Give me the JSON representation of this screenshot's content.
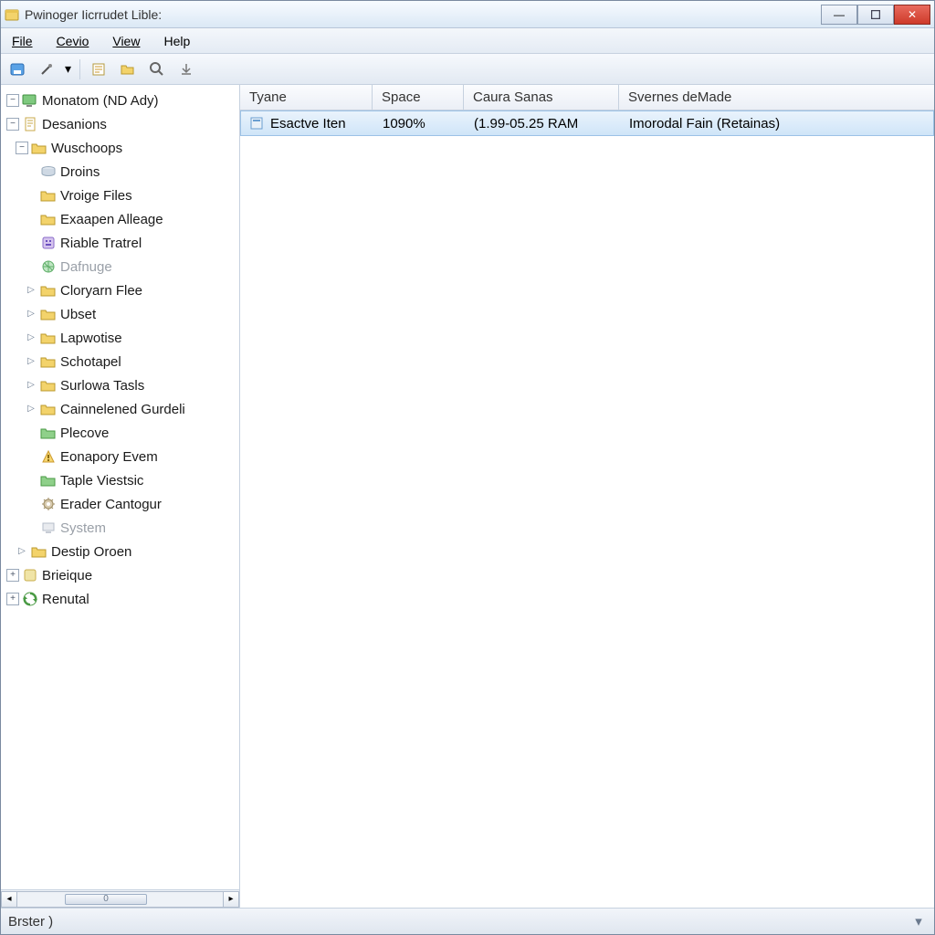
{
  "titlebar": {
    "title": "Pwinoger Iicrrudet Lible:"
  },
  "menu": {
    "file": "File",
    "cevio": "Cevio",
    "view": "View",
    "help": "Help"
  },
  "tree": {
    "root0": "Monatom (ND Ady)",
    "root1": "Desanions",
    "wuschoops": "Wuschoops",
    "droins": "Droins",
    "vroige": "Vroige Files",
    "exaapen": "Exaapen Alleage",
    "riable": "Riable Tratrel",
    "dafnuge": "Dafnuge",
    "cloryarn": "Cloryarn Flee",
    "ubset": "Ubset",
    "lapwotise": "Lapwotise",
    "schotapel": "Schotapel",
    "surlowa": "Surlowa Tasls",
    "cainnel": "Cainnelened Gurdeli",
    "plecove": "Plecove",
    "eonapory": "Eonapory Evem",
    "taple": "Taple Viestsic",
    "erader": "Erader Cantogur",
    "system": "System",
    "destip": "Destip Oroen",
    "brieique": "Brieique",
    "renutal": "Renutal"
  },
  "scroll_thumb": "0",
  "list": {
    "columns": {
      "c0": "Tyane",
      "c1": "Space",
      "c2": "Caura Sanas",
      "c3": "Svernes deMade"
    },
    "widths": {
      "c0": 145,
      "c1": 100,
      "c2": 170,
      "c3": 320
    },
    "rows": [
      {
        "name": "Esactve Iten",
        "space": "1090%",
        "caura": "(1.99-05.25 RAM",
        "svernes": "Imorodal Fain (Retainas)"
      }
    ]
  },
  "status": {
    "text": "Brster )"
  }
}
